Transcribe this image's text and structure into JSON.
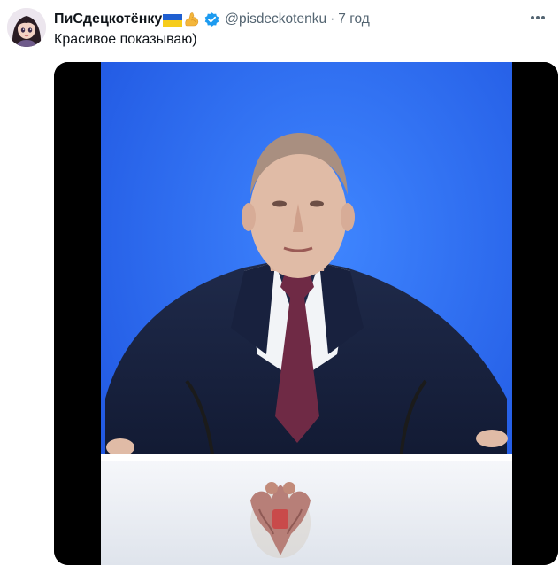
{
  "tweet": {
    "display_name": "ПиСдецкотёнку",
    "handle": "@pisdeckotenku",
    "separator": "·",
    "time": "7 год",
    "text": "Красивое показываю)",
    "icons": {
      "avatar": "avatar-image",
      "flag": "ukraine-flag-icon",
      "emoji": "flexed-biceps-icon",
      "verified": "verified-badge-icon",
      "more": "more-options-icon"
    },
    "colors": {
      "verified": "#1d9bf0",
      "flag_blue": "#1f5fd0",
      "flag_yellow": "#f6cc1b",
      "muscle": "#f4b63a",
      "video_background": "#2f6ff2"
    }
  },
  "media": {
    "type": "video-frame",
    "icon": "video-thumbnail"
  }
}
